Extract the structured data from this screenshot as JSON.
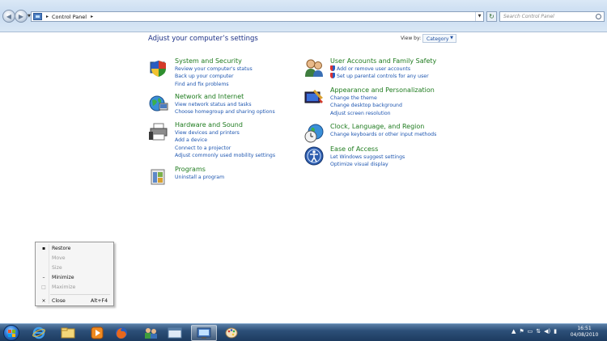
{
  "address": {
    "path": "Control Panel",
    "search_placeholder": "Search Control Panel"
  },
  "header": {
    "title": "Adjust your computer’s settings",
    "view_by_label": "View by:",
    "view_by_value": "Category"
  },
  "categories": [
    {
      "title": "System and Security",
      "icon": "shield-monitor-icon",
      "links": [
        "Review your computer's status",
        "Back up your computer",
        "Find and fix problems"
      ]
    },
    {
      "title": "Network and Internet",
      "icon": "network-globe-icon",
      "links": [
        "View network status and tasks",
        "Choose homegroup and sharing options"
      ]
    },
    {
      "title": "Hardware and Sound",
      "icon": "printer-icon",
      "links": [
        "View devices and printers",
        "Add a device",
        "Connect to a projector",
        "Adjust commonly used mobility settings"
      ]
    },
    {
      "title": "Programs",
      "icon": "programs-icon",
      "links": [
        "Uninstall a program"
      ]
    },
    {
      "title": "User Accounts and Family Safety",
      "icon": "users-icon",
      "links": [
        "Add or remove user accounts",
        "Set up parental controls for any user"
      ]
    },
    {
      "title": "Appearance and Personalization",
      "icon": "display-brush-icon",
      "links": [
        "Change the theme",
        "Change desktop background",
        "Adjust screen resolution"
      ]
    },
    {
      "title": "Clock, Language, and Region",
      "icon": "clock-globe-icon",
      "links": [
        "Change keyboards or other input methods"
      ]
    },
    {
      "title": "Ease of Access",
      "icon": "ease-of-access-icon",
      "links": [
        "Let Windows suggest settings",
        "Optimize visual display"
      ]
    }
  ],
  "context_menu": {
    "items": [
      {
        "label": "Restore",
        "icon": "▪",
        "enabled": true
      },
      {
        "label": "Move",
        "icon": "",
        "enabled": false
      },
      {
        "label": "Size",
        "icon": "",
        "enabled": false
      },
      {
        "label": "Minimize",
        "icon": "–",
        "enabled": true
      },
      {
        "label": "Maximize",
        "icon": "□",
        "enabled": false
      },
      {
        "label": "Close",
        "shortcut": "Alt+F4",
        "icon": "×",
        "enabled": true
      }
    ]
  },
  "taskbar": {
    "time": "16:51",
    "date": "04/08/2010"
  }
}
